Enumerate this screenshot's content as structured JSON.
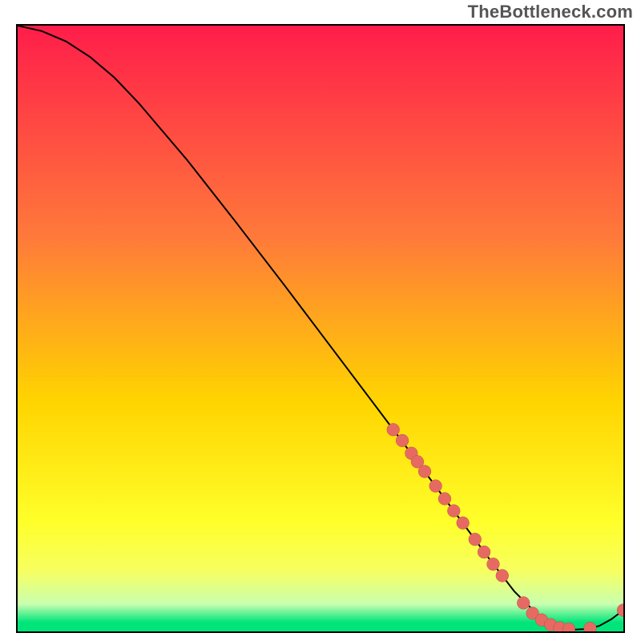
{
  "watermark": "TheBottleneck.com",
  "colors": {
    "gradient_top": "#ff1d4a",
    "gradient_mid1": "#ff7a3a",
    "gradient_mid2": "#ffd400",
    "gradient_mid3": "#ffff2a",
    "gradient_bottom_yellow": "#f7ff60",
    "gradient_pale": "#c9ffb0",
    "gradient_green": "#00e57a",
    "line": "#000000",
    "dot_fill": "#e66a62",
    "dot_stroke": "#8a2b24",
    "border": "#000000"
  },
  "chart_data": {
    "type": "line",
    "title": "",
    "xlabel": "",
    "ylabel": "",
    "xlim": [
      0,
      100
    ],
    "ylim": [
      0,
      100
    ],
    "series": [
      {
        "name": "curve",
        "x": [
          0,
          4,
          8,
          12,
          16,
          20,
          28,
          36,
          44,
          52,
          60,
          66,
          70,
          74,
          78,
          82,
          86,
          90,
          92,
          94,
          96,
          98,
          100
        ],
        "y": [
          100,
          99.1,
          97.4,
          94.8,
          91.4,
          87.2,
          77.8,
          67.6,
          57.2,
          46.6,
          36.0,
          28.0,
          22.6,
          17.2,
          11.8,
          6.6,
          2.6,
          0.6,
          0.3,
          0.4,
          0.9,
          2.0,
          3.5
        ]
      }
    ],
    "dots": [
      {
        "x": 62.0,
        "y": 33.3
      },
      {
        "x": 63.5,
        "y": 31.5
      },
      {
        "x": 65.0,
        "y": 29.4
      },
      {
        "x": 66.0,
        "y": 28.0
      },
      {
        "x": 67.2,
        "y": 26.4
      },
      {
        "x": 69.0,
        "y": 24.0
      },
      {
        "x": 70.5,
        "y": 21.9
      },
      {
        "x": 72.0,
        "y": 19.9
      },
      {
        "x": 73.5,
        "y": 17.9
      },
      {
        "x": 75.5,
        "y": 15.2
      },
      {
        "x": 77.0,
        "y": 13.1
      },
      {
        "x": 78.5,
        "y": 11.1
      },
      {
        "x": 80.0,
        "y": 9.2
      },
      {
        "x": 83.5,
        "y": 4.7
      },
      {
        "x": 85.0,
        "y": 3.0
      },
      {
        "x": 86.5,
        "y": 1.9
      },
      {
        "x": 88.0,
        "y": 1.1
      },
      {
        "x": 89.5,
        "y": 0.6
      },
      {
        "x": 91.0,
        "y": 0.4
      },
      {
        "x": 94.5,
        "y": 0.5
      },
      {
        "x": 100.0,
        "y": 3.5
      }
    ],
    "gradient_stops": [
      {
        "offset": 0.0,
        "color_key": "gradient_top"
      },
      {
        "offset": 0.35,
        "color_key": "gradient_mid1"
      },
      {
        "offset": 0.62,
        "color_key": "gradient_mid2"
      },
      {
        "offset": 0.82,
        "color_key": "gradient_mid3"
      },
      {
        "offset": 0.9,
        "color_key": "gradient_bottom_yellow"
      },
      {
        "offset": 0.955,
        "color_key": "gradient_pale"
      },
      {
        "offset": 0.985,
        "color_key": "gradient_green"
      },
      {
        "offset": 1.0,
        "color_key": "gradient_green"
      }
    ]
  }
}
